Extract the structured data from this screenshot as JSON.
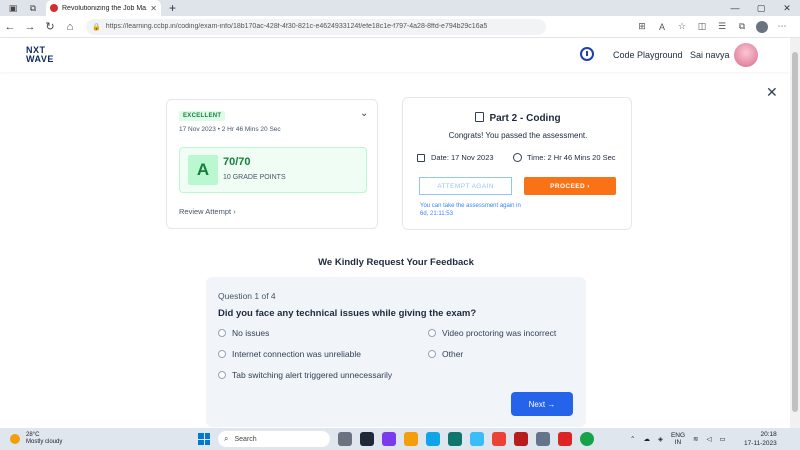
{
  "browser": {
    "tab_title": "Revolutionizing the Job Ma...",
    "url": "https://learning.ccbp.in/coding/exam-info/18b170ac-428f-4f30-821c-e4624933124f/efe18c1e-f797-4a28-8ffd-e794b29c16a5"
  },
  "header": {
    "logo_line1": "NXT",
    "logo_line2": "WAVE",
    "playground_label": "Code Playground",
    "username": "Sai navya"
  },
  "result": {
    "badge": "EXCELLENT",
    "date": "17 Nov 2023",
    "duration": "2 Hr 46 Mins 20 Sec",
    "grade": "A",
    "score": "70",
    "total": "/70",
    "grade_points": "10 GRADE POINTS",
    "review_label": "Review Attempt"
  },
  "part2": {
    "title": "Part 2 - Coding",
    "message": "Congrats! You passed the assessment.",
    "date_label": "Date: 17 Nov 2023",
    "time_label": "Time: 2 Hr 46 Mins 20 Sec",
    "attempt_again": "ATTEMPT AGAIN",
    "proceed": "PROCEED",
    "retake_note": "You can take the assessment again in 6d, 21:11:53"
  },
  "feedback": {
    "title": "We Kindly Request Your Feedback",
    "question_number": "Question 1 of 4",
    "question": "Did you face any technical issues while giving the exam?",
    "options": [
      "No issues",
      "Video proctoring was incorrect",
      "Internet connection was unreliable",
      "Other",
      "Tab switching alert triggered unnecessarily"
    ],
    "next_label": "Next"
  },
  "taskbar": {
    "temperature": "28°C",
    "weather": "Mostly cloudy",
    "search_placeholder": "Search",
    "lang_line1": "ENG",
    "lang_line2": "IN",
    "time": "20:18",
    "date": "17-11-2023"
  }
}
